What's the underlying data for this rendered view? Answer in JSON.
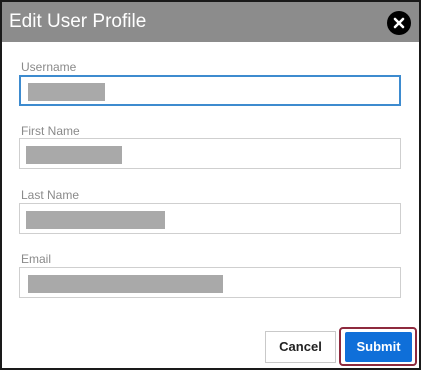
{
  "dialog": {
    "title": "Edit User Profile",
    "close_icon": "close-icon"
  },
  "fields": [
    {
      "label": "Username",
      "value": "",
      "redacted": true,
      "focused": true
    },
    {
      "label": "First Name",
      "value": "",
      "redacted": true,
      "focused": false
    },
    {
      "label": "Last Name",
      "value": "",
      "redacted": true,
      "focused": false
    },
    {
      "label": "Email",
      "value": "",
      "redacted": true,
      "focused": false
    }
  ],
  "actions": {
    "cancel_label": "Cancel",
    "submit_label": "Submit"
  },
  "colors": {
    "titlebar": "#8c8c8c",
    "submit_bg": "#0f6fd9",
    "focus_border": "#3d8bcf",
    "highlight_outline": "#8e2a3e",
    "redaction": "#a9a9a9"
  }
}
